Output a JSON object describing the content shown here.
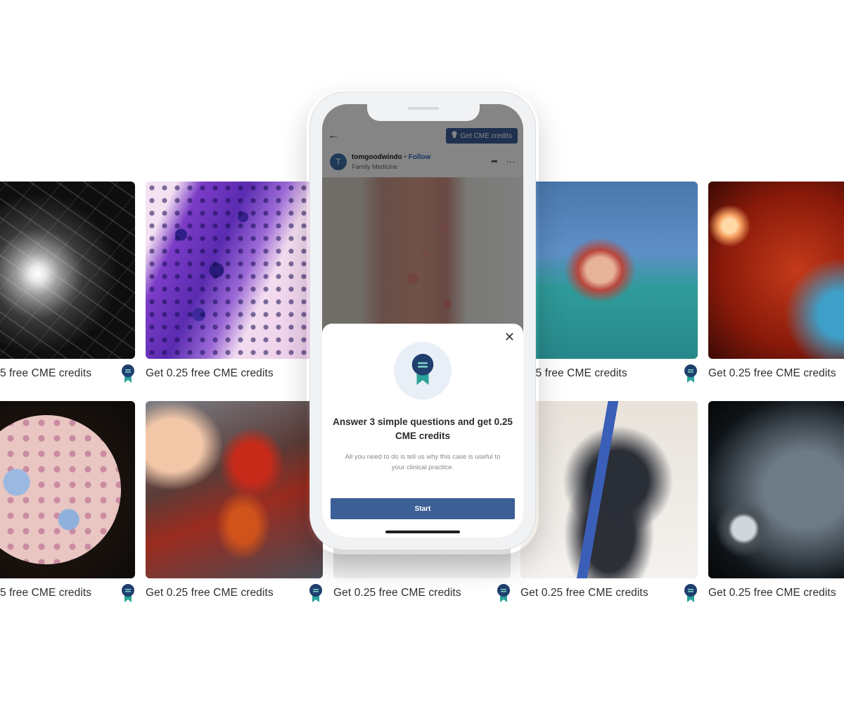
{
  "tiles": {
    "caption": "Get 0.25 free CME credits",
    "caption_partial": "5 free CME credits",
    "items": [
      {
        "name": "angiogram",
        "row": 1
      },
      {
        "name": "purple-histology",
        "row": 1
      },
      {
        "name": "surgery-drapes",
        "row": 1
      },
      {
        "name": "retina",
        "row": 1
      },
      {
        "name": "circular-micrograph",
        "row": 2
      },
      {
        "name": "open-heart-surgery",
        "row": 2
      },
      {
        "name": "xray",
        "row": 2
      },
      {
        "name": "legs",
        "row": 2
      },
      {
        "name": "mri",
        "row": 2
      }
    ],
    "badge_icon": "cme-ribbon-icon"
  },
  "phone": {
    "topbar": {
      "back_icon": "back-arrow-icon",
      "cme_button_label": "Get CME credits"
    },
    "post": {
      "avatar_initial": "T",
      "username": "tomgoodwindo",
      "separator": "•",
      "follow_label": "Follow",
      "specialty": "Family Medicine",
      "share_icon": "share-icon",
      "more_icon": "more-icon"
    },
    "sheet": {
      "close_icon": "close-icon",
      "title": "Answer 3 simple questions and get 0.25 CME credits",
      "description": "All you need to do is tell us why this case is useful to your clinical practice.",
      "start_label": "Start"
    }
  },
  "colors": {
    "accent": "#3d5f97",
    "ribbon_teal": "#2aa39a",
    "ribbon_navy": "#1f3f6e"
  }
}
